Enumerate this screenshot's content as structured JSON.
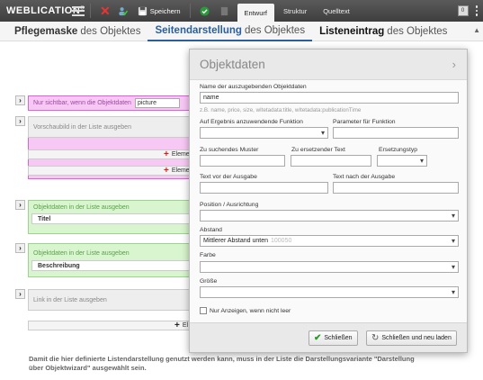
{
  "app": {
    "logo": "WEBLICATION",
    "logo_mark": "®",
    "save_label": "Speichern",
    "tabs": [
      "Entwurf",
      "Struktur",
      "Quelltext"
    ],
    "right_box": "0"
  },
  "subtabs": [
    {
      "bold": "Pflegemaske",
      "rest": "des Objektes"
    },
    {
      "bold": "Seitendarstellung",
      "rest": "des Objektes"
    },
    {
      "bold": "Listeneintrag",
      "rest": "des Objektes"
    }
  ],
  "main": {
    "condition_label": "Nur sichtbar, wenn die Objektdaten",
    "condition_value": "picture",
    "preview_label": "Vorschaubild in der Liste ausgeben",
    "elem_label": "Eleme",
    "elem_label2": "Eleme",
    "obj1_label": "Objektdaten in der Liste ausgeben",
    "obj1_field": "Titel",
    "obj2_label": "Objektdaten in der Liste ausgeben",
    "obj2_field": "Beschreibung",
    "link_label": "Link in der Liste ausgeben",
    "add_label": "El",
    "footer": "Damit die hier definierte Listendarstellung genutzt werden kann, muss in der Liste die Darstellungsvariante \"Darstellung über Objektwizard\" ausgewählt sein."
  },
  "dialog": {
    "title": "Objektdaten",
    "name_label": "Name der auszugebenden Objektdaten",
    "name_value": "name",
    "name_hint": "z.B. name, price, size, wItetadata:title, wItetadata:publicationTime",
    "func_label": "Auf Ergebnis anzuwendende Funktion",
    "param_label": "Parameter für Funktion",
    "search_label": "Zu suchendes Muster",
    "replace_label": "Zu ersetzender Text",
    "replace_type_label": "Ersetzungstyp",
    "before_label": "Text vor der Ausgabe",
    "after_label": "Text nach der Ausgabe",
    "position_label": "Position / Ausrichtung",
    "spacing_label": "Abstand",
    "spacing_value": "Mittlerer Abstand unten",
    "spacing_code": "100050",
    "color_label": "Farbe",
    "size_label": "Größe",
    "only_if_label": "Nur Anzeigen, wenn nicht leer",
    "close_button": "Schließen",
    "close_reload_button": "Schließen und neu laden"
  }
}
